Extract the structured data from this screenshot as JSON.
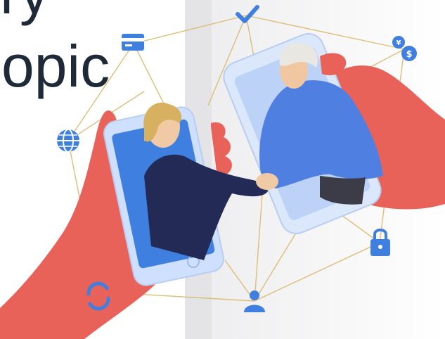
{
  "slide": {
    "title_line1": "ry",
    "title_line2": "opic"
  },
  "illustration": {
    "subject": "two-hands-holding-phones-handshake",
    "icons": [
      "check-icon",
      "credit-card-icon",
      "currency-exchange-icon",
      "globe-icon",
      "lock-icon",
      "user-icon",
      "sync-icon"
    ],
    "colors": {
      "hand": "#e8625a",
      "phone": "#cfe0ff",
      "screen": "#3f7fe0",
      "jacket_dark": "#222a55",
      "hoodie": "#4f7fe0",
      "icon_blue": "#3f7fe0",
      "line_gold": "#d9b86a",
      "title": "#1f2a38"
    }
  }
}
